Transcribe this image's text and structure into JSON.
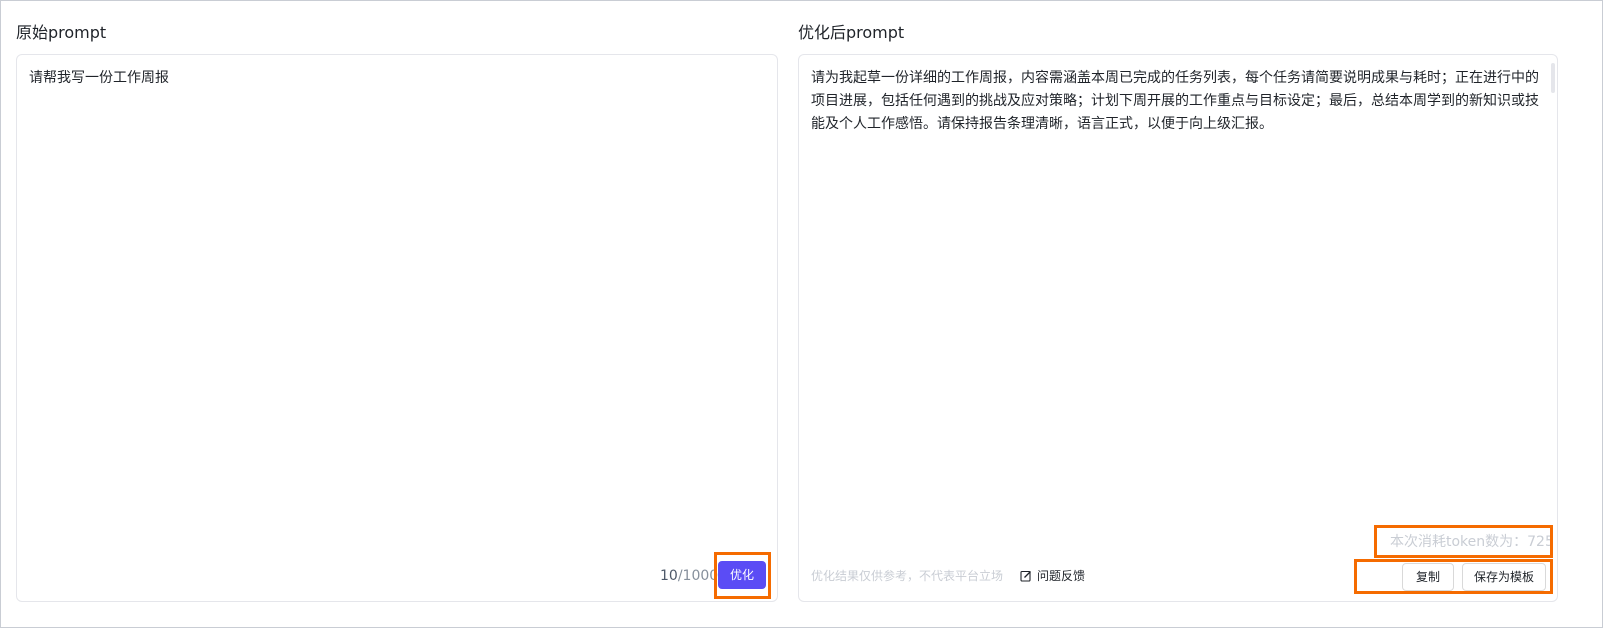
{
  "left": {
    "title": "原始prompt",
    "input_value": "请帮我写一份工作周报",
    "char_count": "10",
    "char_max": "/1000",
    "optimize_button": "优化"
  },
  "right": {
    "title": "优化后prompt",
    "output_text": "请为我起草一份详细的工作周报，内容需涵盖本周已完成的任务列表，每个任务请简要说明成果与耗时；正在进行中的项目进展，包括任何遇到的挑战及应对策略；计划下周开展的工作重点与目标设定；最后，总结本周学到的新知识或技能及个人工作感悟。请保持报告条理清晰，语言正式，以便于向上级汇报。",
    "token_usage": "本次消耗token数为：725",
    "disclaimer": "优化结果仅供参考，不代表平台立场",
    "feedback_label": "问题反馈",
    "feedback_icon": "edit-icon",
    "copy_button": "复制",
    "save_template_button": "保存为模板"
  },
  "colors": {
    "primary": "#5b4cf5",
    "highlight": "#f56b00",
    "border": "#e5e6eb",
    "muted_text": "#c9cdd4"
  }
}
